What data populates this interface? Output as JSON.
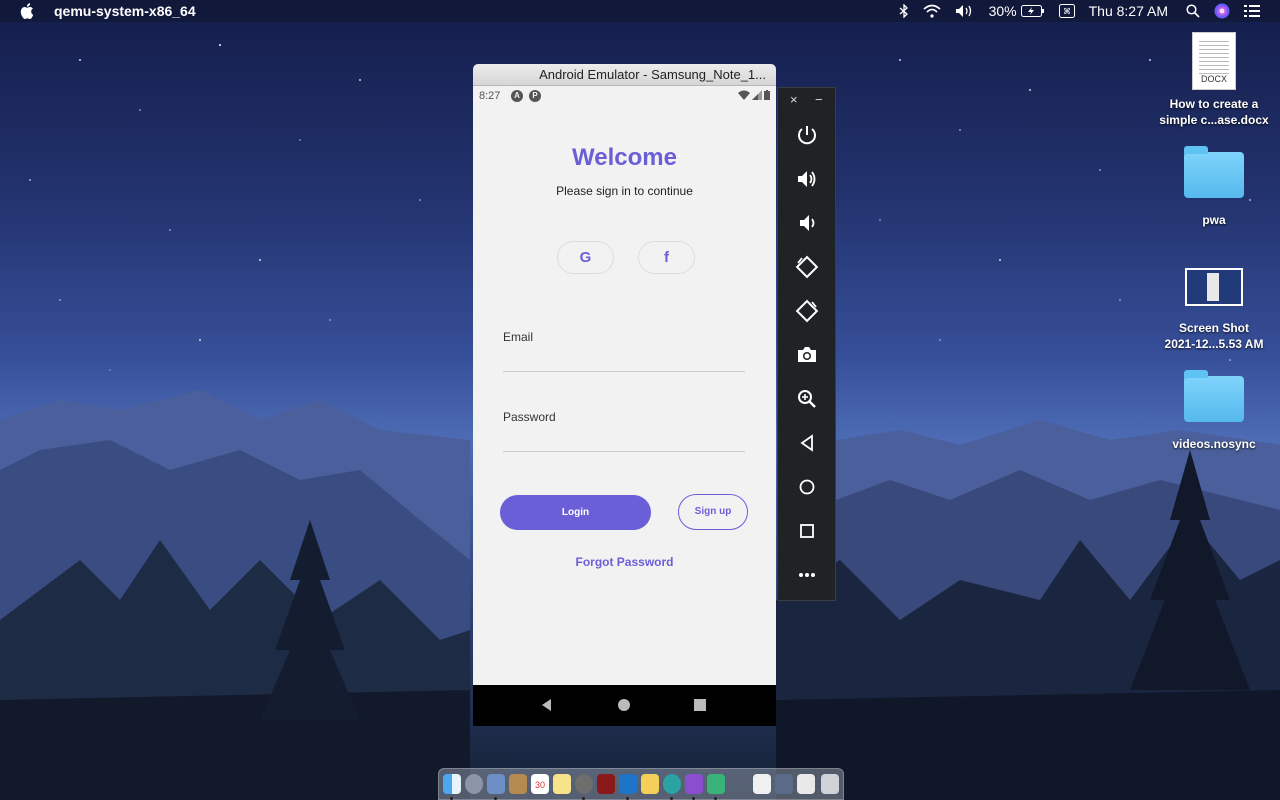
{
  "menubar": {
    "app_name": "qemu-system-x86_64",
    "battery": "30%",
    "clock": "Thu 8:27 AM",
    "icons": [
      "apple-icon",
      "bluetooth-icon",
      "wifi-icon",
      "volume-icon",
      "battery-icon",
      "input-source-icon",
      "search-icon",
      "siri-icon",
      "control-center-icon"
    ]
  },
  "desktop": {
    "items": [
      {
        "label_line1": "How to create a",
        "label_line2": "simple c...ase.docx",
        "type": "document",
        "ext": "DOCX"
      },
      {
        "label_line1": "pwa",
        "label_line2": "",
        "type": "folder"
      },
      {
        "label_line1": "Screen Shot",
        "label_line2": "2021-12...5.53 AM",
        "type": "screenshot"
      },
      {
        "label_line1": "videos.nosync",
        "label_line2": "",
        "type": "folder"
      }
    ]
  },
  "emulator": {
    "window_title": "Android Emulator - Samsung_Note_1...",
    "status": {
      "time": "8:27",
      "icon_a": "A",
      "icon_b": "P"
    },
    "screen": {
      "welcome": "Welcome",
      "subtitle": "Please sign in to continue",
      "google_label": "G",
      "facebook_label": "f",
      "email_label": "Email",
      "email_value": "",
      "password_label": "Password",
      "password_value": "",
      "login_label": "Login",
      "signup_label": "Sign up",
      "forgot_label": "Forgot Password"
    },
    "toolbar": {
      "close": "×",
      "minimize": "−",
      "buttons": [
        "power-icon",
        "volume-up-icon",
        "volume-down-icon",
        "rotate-left-icon",
        "rotate-right-icon",
        "camera-icon",
        "zoom-icon",
        "back-icon",
        "home-icon",
        "overview-icon",
        "more-icon"
      ]
    }
  },
  "dock": {
    "apps": [
      "finder-icon",
      "launchpad-icon",
      "preview-icon",
      "notes-icon",
      "calendar-icon",
      "stickies-icon",
      "disk-utility-icon",
      "acrobat-icon",
      "vscode-icon",
      "finder-folder-icon",
      "edge-icon",
      "github-icon",
      "android-studio-icon",
      "document-icon",
      "downloads-icon",
      "trash-icon"
    ],
    "calendar_day": "30"
  },
  "colors": {
    "accent": "#6b5fd8",
    "screen_bg": "#f2f2f2",
    "toolbar_bg": "#202326"
  }
}
